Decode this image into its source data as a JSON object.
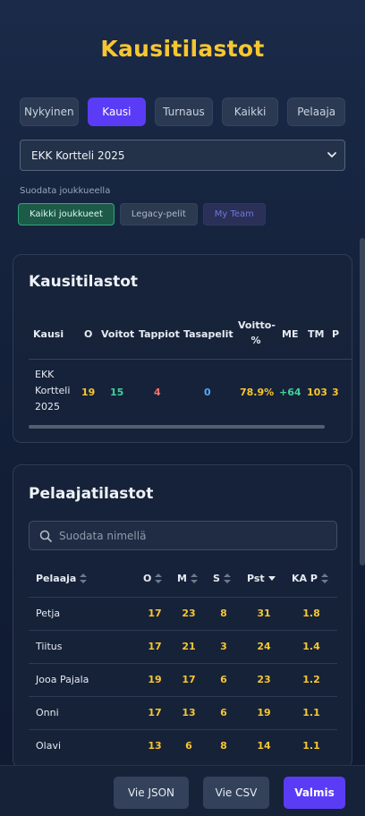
{
  "page_title": "Kausitilastot",
  "tabs": [
    {
      "label": "Nykyinen",
      "active": false
    },
    {
      "label": "Kausi",
      "active": true
    },
    {
      "label": "Turnaus",
      "active": false
    },
    {
      "label": "Kaikki",
      "active": false
    },
    {
      "label": "Pelaaja",
      "active": false
    }
  ],
  "season_select": {
    "value": "EKK Kortteli 2025",
    "icon": "chevron-down-icon"
  },
  "team_filter": {
    "label": "Suodata joukkueella",
    "chips": [
      "Kaikki joukkueet",
      "Legacy-pelit",
      "My Team"
    ]
  },
  "season_card": {
    "title": "Kausitilastot",
    "headers": [
      "Kausi",
      "O",
      "Voitot",
      "Tappiot",
      "Tasapelit",
      "Voitto-%",
      "ME",
      "TM",
      "P"
    ],
    "row": {
      "season": "EKK Kortteli 2025",
      "o": "19",
      "wins": "15",
      "losses": "4",
      "ties": "0",
      "win_pct": "78.9%",
      "me": "+64",
      "tm": "103",
      "p": "3"
    }
  },
  "player_card": {
    "title": "Pelaajatilastot",
    "search_placeholder": "Suodata nimellä",
    "headers": [
      "Pelaaja",
      "O",
      "M",
      "S",
      "Pst",
      "KA P"
    ],
    "rows": [
      {
        "name": "Petja",
        "o": "17",
        "m": "23",
        "s": "8",
        "pst": "31",
        "kap": "1.8"
      },
      {
        "name": "Tiitus",
        "o": "17",
        "m": "21",
        "s": "3",
        "pst": "24",
        "kap": "1.4"
      },
      {
        "name": "Jooa Pajala",
        "o": "19",
        "m": "17",
        "s": "6",
        "pst": "23",
        "kap": "1.2"
      },
      {
        "name": "Onni",
        "o": "17",
        "m": "13",
        "s": "6",
        "pst": "19",
        "kap": "1.1"
      },
      {
        "name": "Olavi",
        "o": "13",
        "m": "6",
        "s": "8",
        "pst": "14",
        "kap": "1.1"
      }
    ]
  },
  "footer": {
    "json_button": "Vie JSON",
    "csv_button": "Vie CSV",
    "done_button": "Valmis"
  },
  "colors": {
    "accent": "#5b3cf6",
    "title": "#f7c631",
    "positive": "#3fd19a",
    "negative": "#f2716b",
    "neutral_blue": "#5aa6f5"
  }
}
